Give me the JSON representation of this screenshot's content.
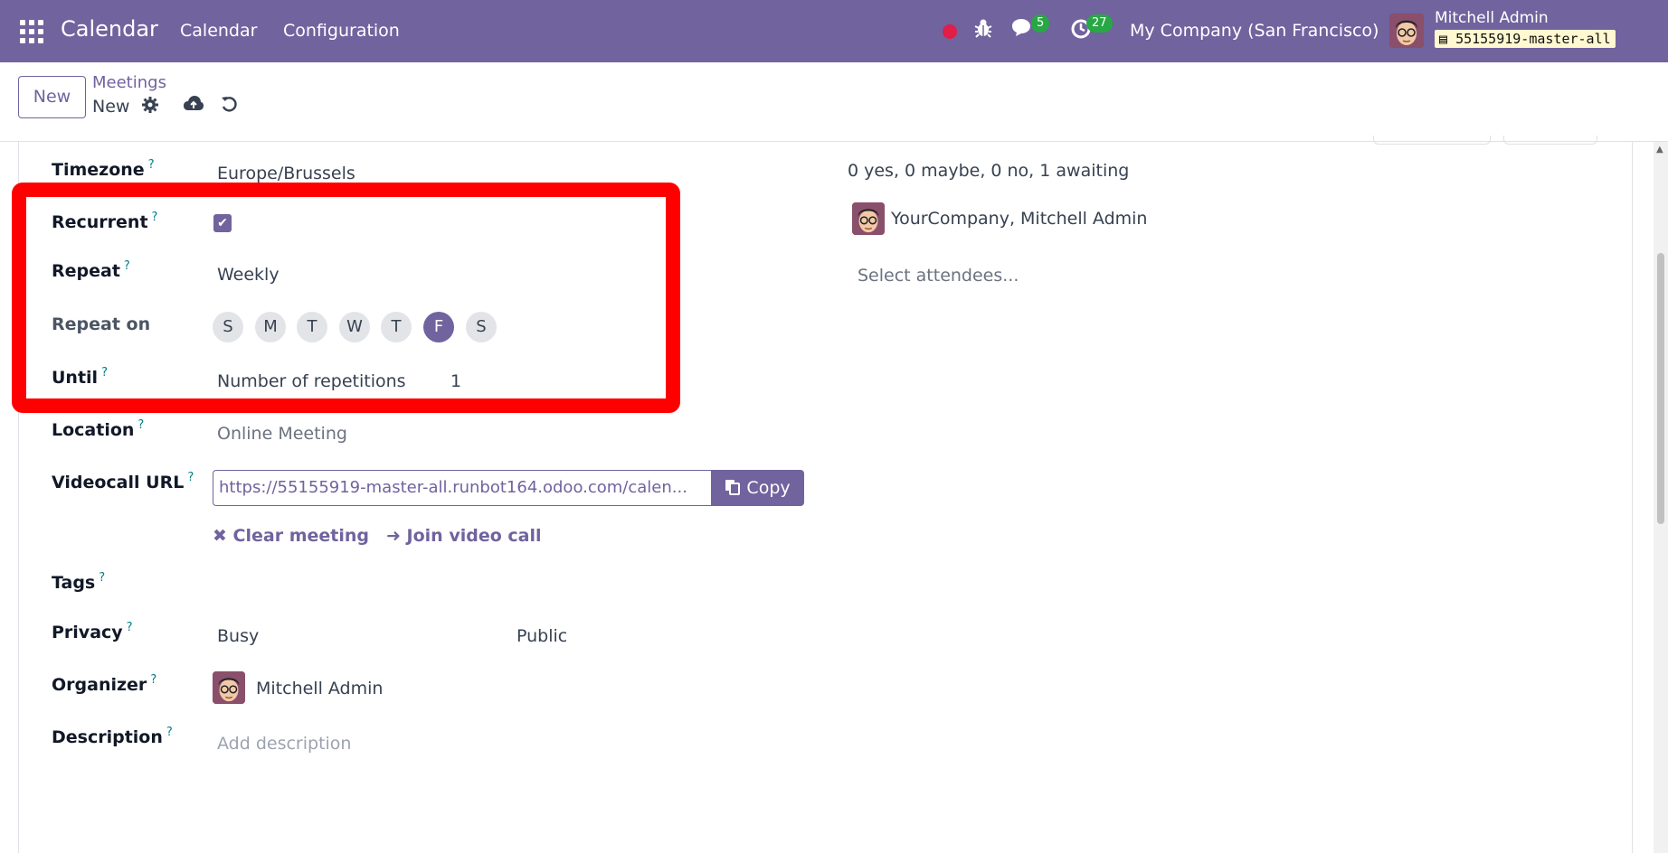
{
  "navbar": {
    "app_title": "Calendar",
    "menu": [
      "Calendar",
      "Configuration"
    ],
    "messages_count": "5",
    "activities_count": "27",
    "company": "My Company (San Francisco)",
    "user_name": "Mitchell Admin",
    "database": "55155919-master-all"
  },
  "control": {
    "new_label": "New",
    "breadcrumb": "Meetings",
    "record_name": "New"
  },
  "form": {
    "timezone": {
      "label": "Timezone",
      "value": "Europe/Brussels"
    },
    "recurrent": {
      "label": "Recurrent",
      "checked": true
    },
    "repeat": {
      "label": "Repeat",
      "value": "Weekly"
    },
    "repeat_on": {
      "label": "Repeat on",
      "days": [
        "S",
        "M",
        "T",
        "W",
        "T",
        "F",
        "S"
      ],
      "selected_day": "F"
    },
    "until": {
      "label": "Until",
      "value": "Number of repetitions",
      "count": "1"
    },
    "location": {
      "label": "Location",
      "placeholder": "Online Meeting"
    },
    "videocall": {
      "label": "Videocall URL",
      "url": "https://55155919-master-all.runbot164.odoo.com/calen...",
      "copy_label": "Copy",
      "clear_label": "Clear meeting",
      "join_label": "Join video call"
    },
    "tags": {
      "label": "Tags"
    },
    "privacy": {
      "label": "Privacy",
      "show_as": "Busy",
      "privacy": "Public"
    },
    "organizer": {
      "label": "Organizer",
      "value": "Mitchell Admin"
    },
    "description": {
      "label": "Description",
      "placeholder": "Add description"
    }
  },
  "attendees": {
    "summary": "0 yes, 0 maybe, 0 no, 1 awaiting",
    "list": [
      "YourCompany, Mitchell Admin"
    ],
    "placeholder": "Select attendees..."
  },
  "colors": {
    "brand": "#71639e",
    "highlight": "#ff0000",
    "help": "#017e84",
    "badge": "#28a745"
  }
}
